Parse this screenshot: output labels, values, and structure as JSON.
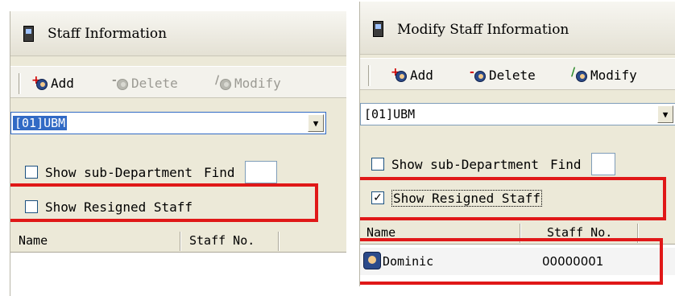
{
  "left": {
    "title": "Staff Information",
    "toolbar": {
      "add_label": "Add",
      "delete_label": "Delete",
      "modify_label": "Modify"
    },
    "department_value": "[01]UBM",
    "show_sub_department_label": "Show sub-Department",
    "find_label": "Find",
    "show_resigned_label": "Show Resigned Staff",
    "show_resigned_checked": false,
    "columns": {
      "name": "Name",
      "staff_no": "Staff No."
    }
  },
  "right": {
    "title": "Modify Staff Information",
    "toolbar": {
      "add_label": "Add",
      "delete_label": "Delete",
      "modify_label": "Modify"
    },
    "department_value": "[01]UBM",
    "show_sub_department_label": "Show sub-Department",
    "find_label": "Find",
    "show_resigned_label": "Show Resigned Staff",
    "show_resigned_checked": true,
    "check_mark": "✓",
    "columns": {
      "name": "Name",
      "staff_no": "Staff No."
    },
    "rows": [
      {
        "name": "Dominic",
        "staff_no": "00000001"
      }
    ]
  },
  "icons": {
    "window": "window-icon",
    "add": "add-user-icon",
    "delete": "delete-user-icon",
    "modify": "modify-user-icon",
    "dropdown": "chevron-down-icon",
    "person": "person-icon"
  },
  "colors": {
    "highlight_box": "#e01818",
    "window_bg": "#ece9d8",
    "field_border": "#7f9db9"
  }
}
